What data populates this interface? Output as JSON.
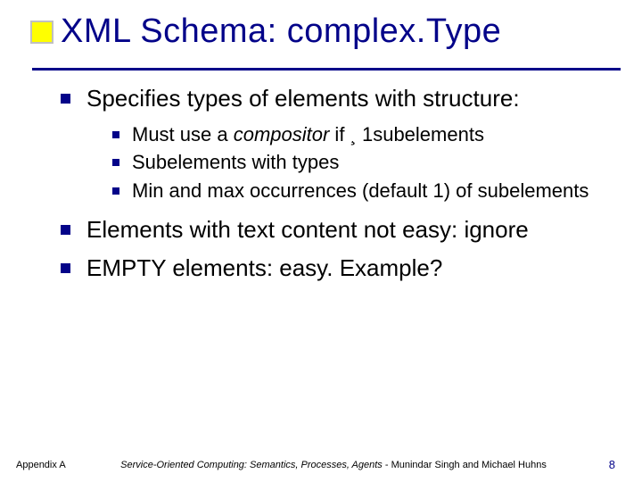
{
  "title": "XML Schema: complex.Type",
  "bullets": {
    "b1": "Specifies types of elements with structure:",
    "sub1_pre": "Must use a ",
    "sub1_em": "compositor",
    "sub1_post": " if ¸ 1subelements",
    "sub2": "Subelements with types",
    "sub3": "Min and max occurrences (default 1) of subelements",
    "b2": "Elements with text content not easy: ignore",
    "b3": "EMPTY elements: easy.  Example?"
  },
  "footer": {
    "left": "Appendix A",
    "book": "Service-Oriented Computing: Semantics, Processes, Agents",
    "authors": " - Munindar Singh and Michael Huhns",
    "page": "8"
  }
}
